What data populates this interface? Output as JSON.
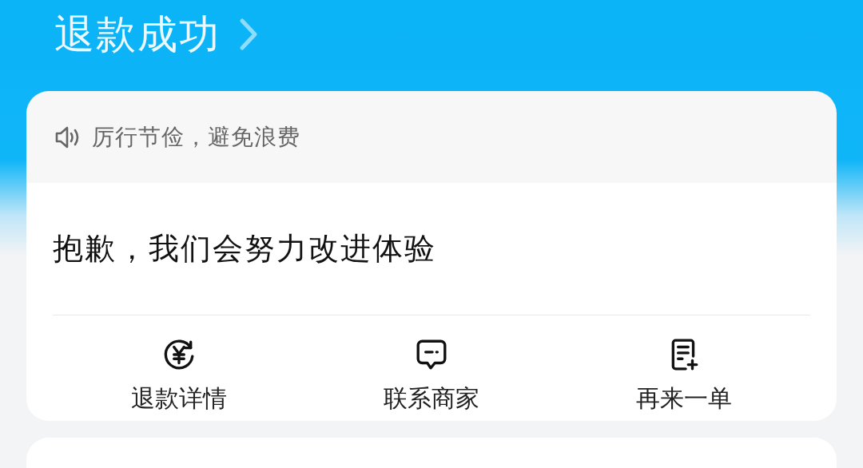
{
  "header": {
    "title": "退款成功"
  },
  "notice": {
    "text": "厉行节俭，避免浪费"
  },
  "card": {
    "message": "抱歉，我们会努力改进体验"
  },
  "actions": [
    {
      "kind": "refund",
      "label": "退款详情"
    },
    {
      "kind": "chat",
      "label": "联系商家"
    },
    {
      "kind": "reorder",
      "label": "再来一单"
    }
  ]
}
